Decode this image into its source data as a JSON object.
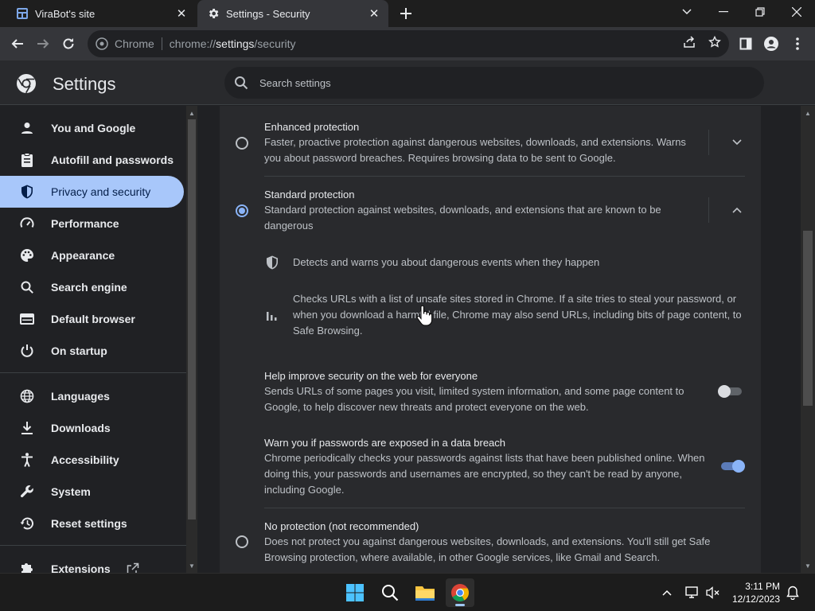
{
  "tabs": [
    {
      "title": "ViraBot's site",
      "active": false
    },
    {
      "title": "Settings - Security",
      "active": true
    }
  ],
  "omnibox": {
    "chip": "Chrome",
    "url_prefix": "chrome://",
    "url_host": "settings",
    "url_path": "/security"
  },
  "settings": {
    "title": "Settings",
    "search_placeholder": "Search settings"
  },
  "sidebar": {
    "items": [
      {
        "label": "You and Google",
        "icon": "person-icon"
      },
      {
        "label": "Autofill and passwords",
        "icon": "clipboard-icon"
      },
      {
        "label": "Privacy and security",
        "icon": "shield-icon",
        "active": true
      },
      {
        "label": "Performance",
        "icon": "speedometer-icon"
      },
      {
        "label": "Appearance",
        "icon": "palette-icon"
      },
      {
        "label": "Search engine",
        "icon": "search-icon"
      },
      {
        "label": "Default browser",
        "icon": "browser-icon"
      },
      {
        "label": "On startup",
        "icon": "power-icon"
      },
      {
        "label": "Languages",
        "icon": "globe-icon"
      },
      {
        "label": "Downloads",
        "icon": "download-icon"
      },
      {
        "label": "Accessibility",
        "icon": "accessibility-icon"
      },
      {
        "label": "System",
        "icon": "wrench-icon"
      },
      {
        "label": "Reset settings",
        "icon": "history-icon"
      },
      {
        "label": "Extensions",
        "icon": "puzzle-icon"
      }
    ]
  },
  "main": {
    "enhanced": {
      "title": "Enhanced protection",
      "desc": "Faster, proactive protection against dangerous websites, downloads, and extensions. Warns you about password breaches. Requires browsing data to be sent to Google.",
      "selected": false
    },
    "standard": {
      "title": "Standard protection",
      "desc": "Standard protection against websites, downloads, and extensions that are known to be dangerous",
      "selected": true,
      "detail1": "Detects and warns you about dangerous events when they happen",
      "detail2": "Checks URLs with a list of unsafe sites stored in Chrome. If a site tries to steal your password, or when you download a harmful file, Chrome may also send URLs, including bits of page content, to Safe Browsing."
    },
    "help_improve": {
      "title": "Help improve security on the web for everyone",
      "desc": "Sends URLs of some pages you visit, limited system information, and some page content to Google, to help discover new threats and protect everyone on the web.",
      "enabled": false
    },
    "warn_passwords": {
      "title": "Warn you if passwords are exposed in a data breach",
      "desc": "Chrome periodically checks your passwords against lists that have been published online. When doing this, your passwords and usernames are encrypted, so they can't be read by anyone, including Google.",
      "enabled": true
    },
    "no_protection": {
      "title": "No protection (not recommended)",
      "desc": "Does not protect you against dangerous websites, downloads, and extensions. You'll still get Safe Browsing protection, where available, in other Google services, like Gmail and Search.",
      "selected": false
    }
  },
  "taskbar": {
    "time": "3:11 PM",
    "date": "12/12/2023"
  },
  "colors": {
    "accent": "#8ab4f8",
    "active_nav": "#a8c7fa",
    "background": "#202124",
    "card": "#292a2d"
  }
}
